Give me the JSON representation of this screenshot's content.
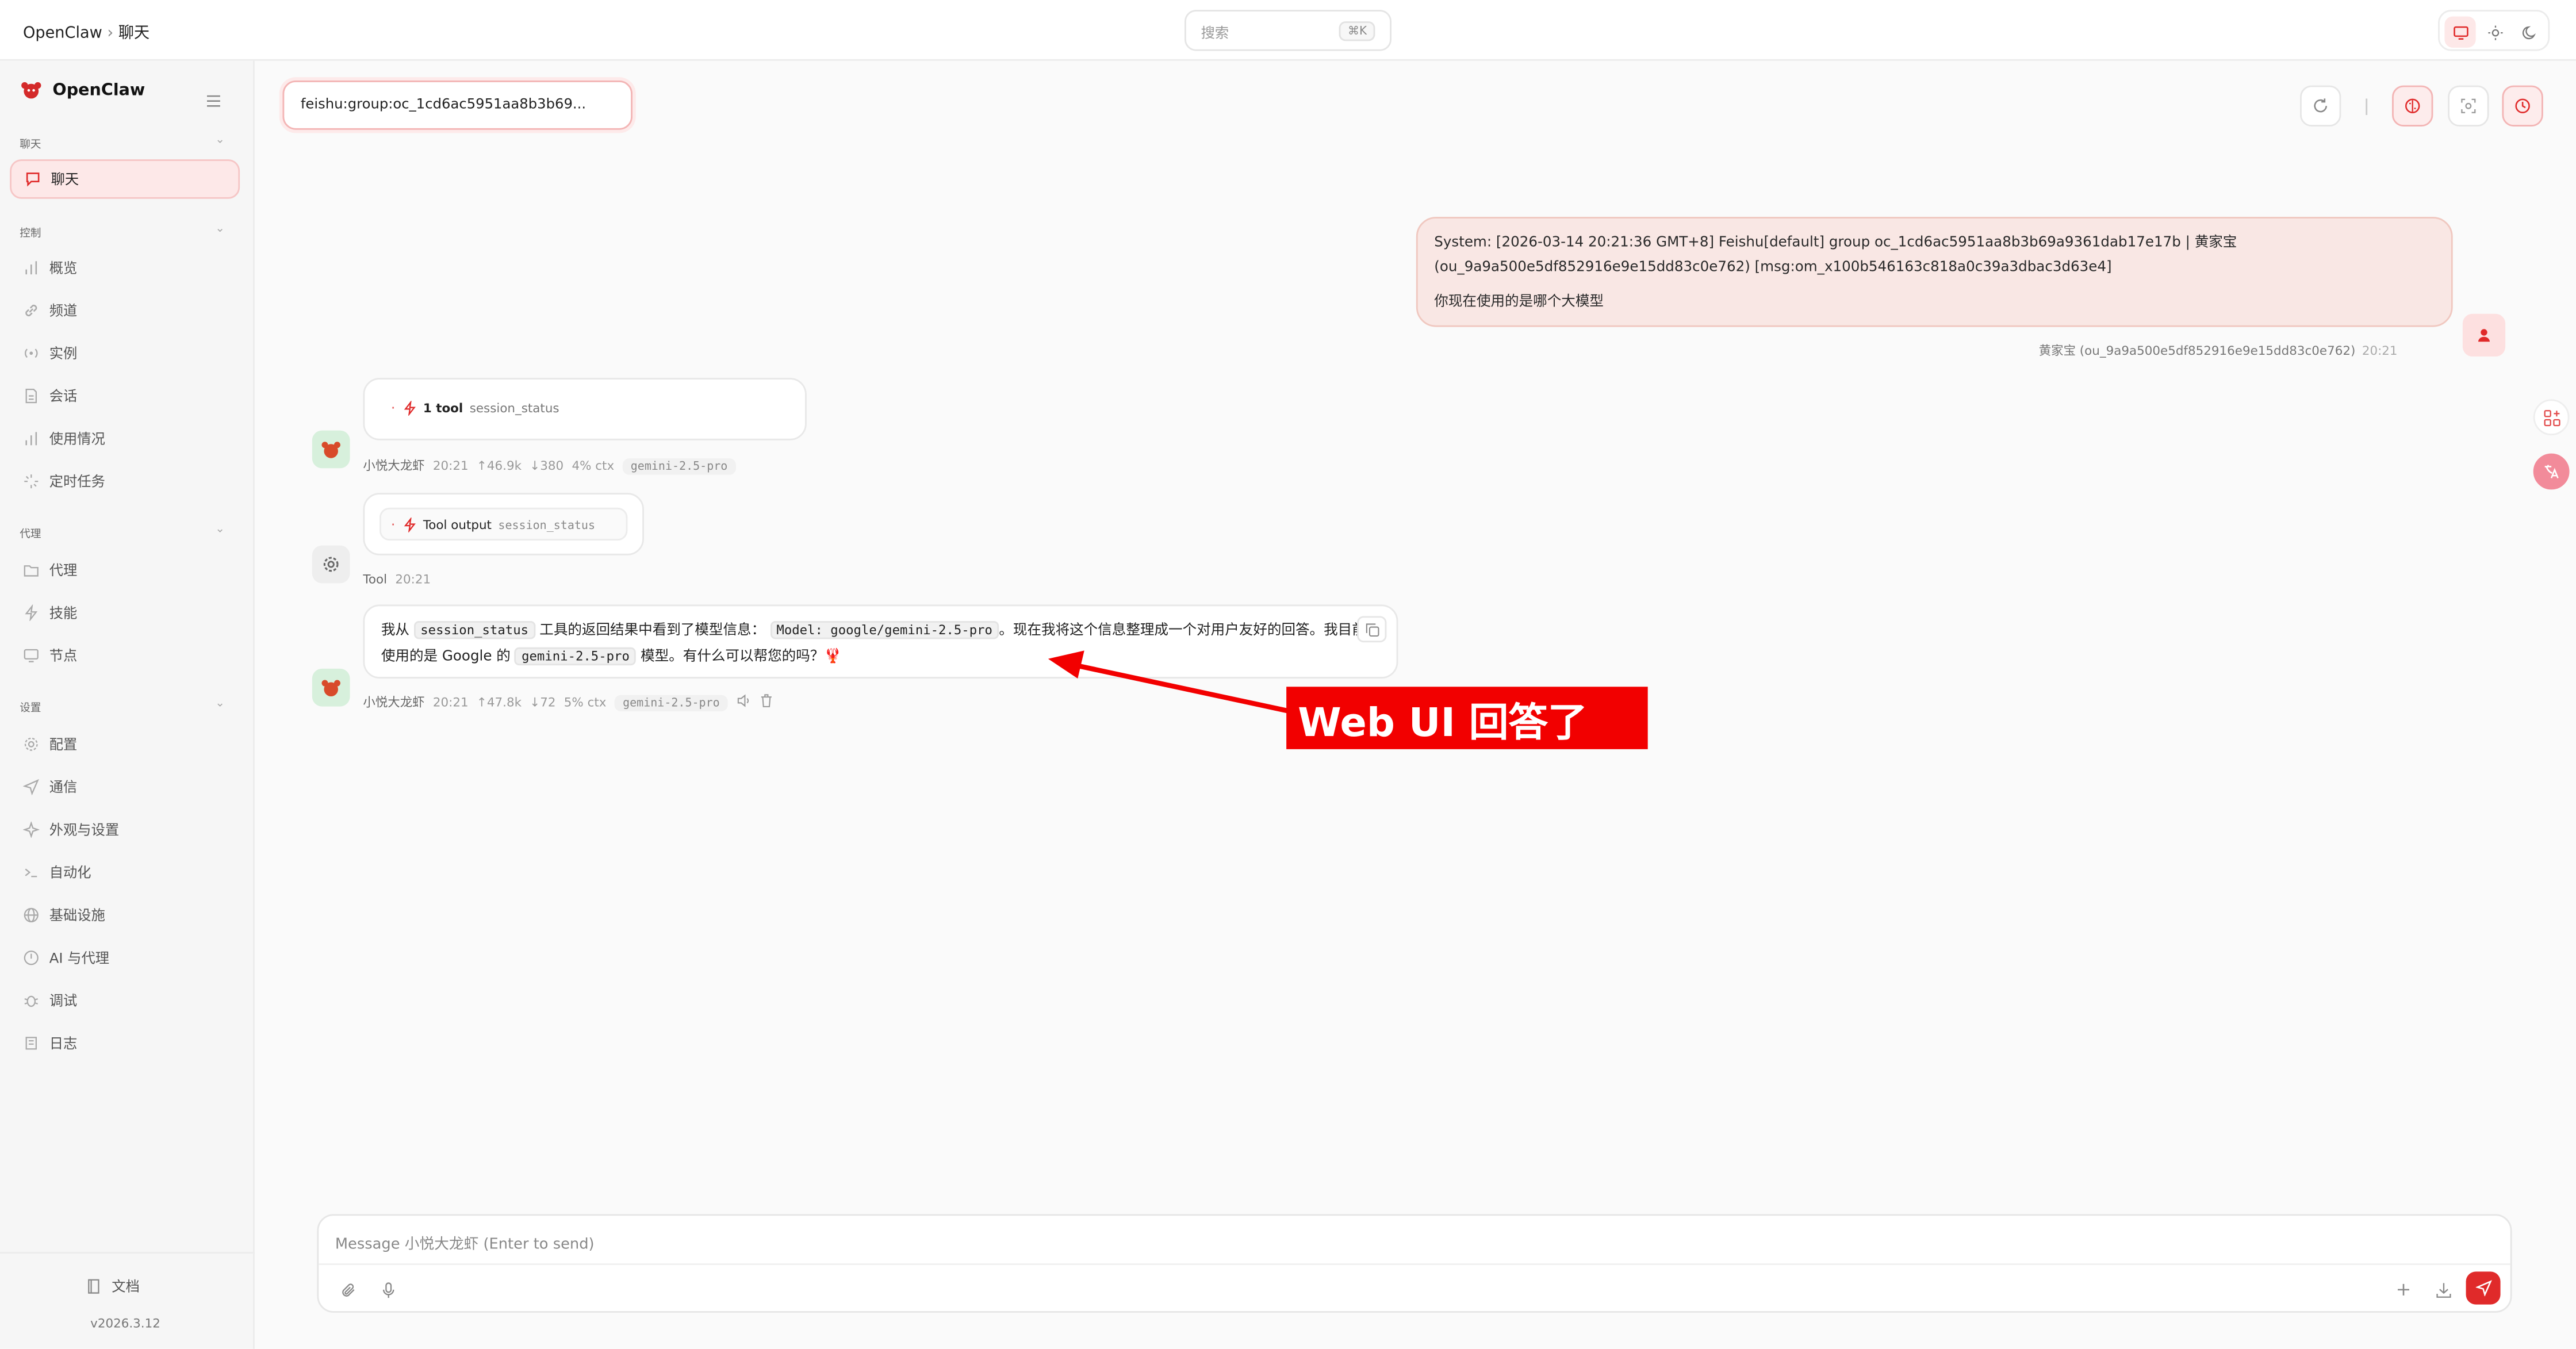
{
  "header": {
    "breadcrumb_root": "OpenClaw",
    "breadcrumb_sep": "›",
    "breadcrumb_current": "聊天",
    "search_placeholder": "搜索",
    "search_shortcut": "⌘K"
  },
  "sidebar": {
    "brand": "OpenClaw",
    "sections": {
      "chat": "聊天",
      "control": "控制",
      "agent": "代理",
      "settings": "设置"
    },
    "items": {
      "chat": "聊天",
      "overview": "概览",
      "channels": "频道",
      "instances": "实例",
      "sessions": "会话",
      "usage": "使用情况",
      "cron": "定时任务",
      "agents": "代理",
      "skills": "技能",
      "nodes": "节点",
      "config": "配置",
      "comms": "通信",
      "appearance": "外观与设置",
      "automation": "自动化",
      "infra": "基础设施",
      "ai_agents": "AI 与代理",
      "debug": "调试",
      "logs": "日志"
    },
    "docs": "文档",
    "version": "v2026.3.12"
  },
  "session": {
    "key": "feishu:group:oc_1cd6ac5951aa8b3b69..."
  },
  "messages": {
    "user_line1": "System: [2026-03-14 20:21:36 GMT+8] Feishu[default] group oc_1cd6ac5951aa8b3b69a9361dab17e17b | 黄家宝",
    "user_line2": "(ou_9a9a500e5df852916e9e15dd83c0e762) [msg:om_x100b546163c818a0c39a3dbac3d63e4]",
    "user_question": "你现在使用的是哪个大模型",
    "user_sender": "黄家宝 (ou_9a9a500e5df852916e9e15dd83c0e762)",
    "user_time": "20:21",
    "tool_call": {
      "count": "1 tool",
      "name": "session_status"
    },
    "bot1_meta": {
      "name": "小悦大龙虾",
      "time": "20:21",
      "up": "↑46.9k",
      "down": "↓380",
      "ctx": "4% ctx",
      "model": "gemini-2.5-pro"
    },
    "tool_output": {
      "label": "Tool output",
      "name": "session_status"
    },
    "tool_meta": {
      "name": "Tool",
      "time": "20:21"
    },
    "answer": {
      "p1": "我从",
      "c1": "session_status",
      "p2": "工具的返回结果中看到了模型信息：",
      "c2": "Model: google/gemini-2.5-pro",
      "p3": "。现在我将这个信息整理成一个对用户友好的回答。我目前使用的是 Google 的",
      "c3": "gemini-2.5-pro",
      "p4": "模型。有什么可以帮您的吗？🦞"
    },
    "bot2_meta": {
      "name": "小悦大龙虾",
      "time": "20:21",
      "up": "↑47.8k",
      "down": "↓72",
      "ctx": "5% ctx",
      "model": "gemini-2.5-pro"
    }
  },
  "annotation": {
    "text": "Web UI 回答了",
    "color": "#f20000"
  },
  "composer": {
    "placeholder": "Message 小悦大龙虾 (Enter to send)"
  },
  "colors": {
    "accent": "#e02a2a",
    "accent_soft": "#fde8e8"
  }
}
